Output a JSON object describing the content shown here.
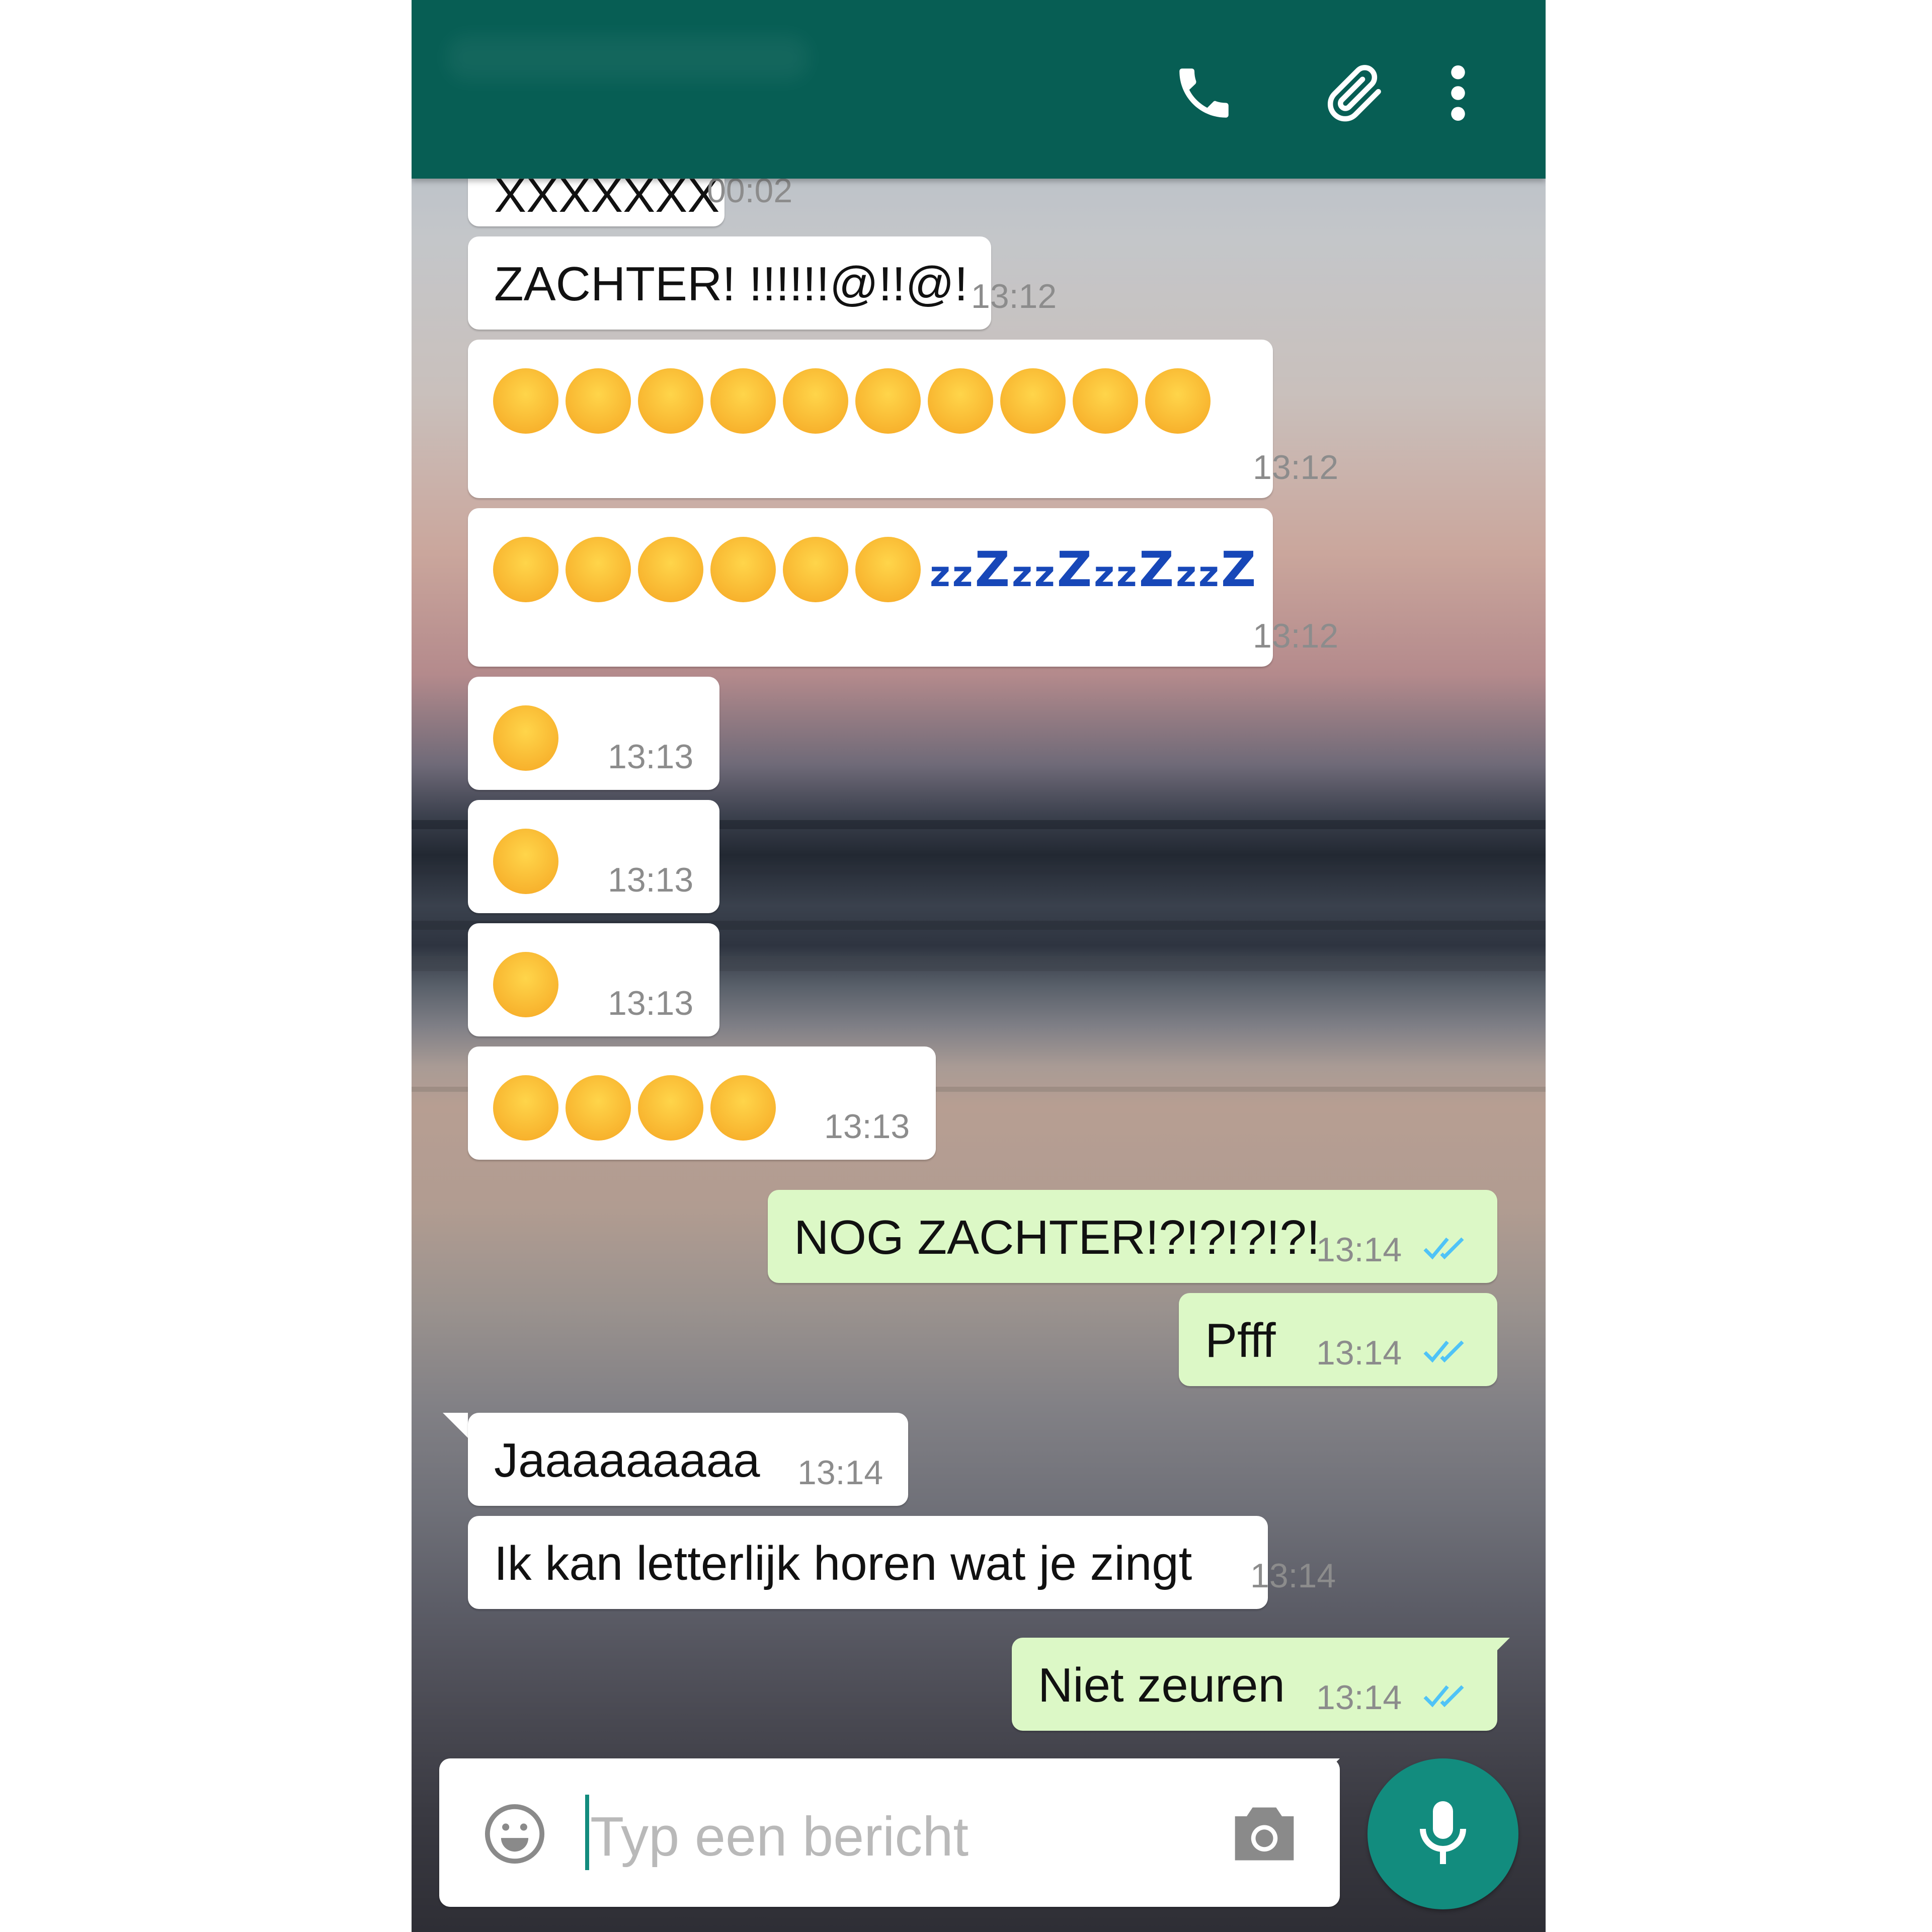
{
  "header": {
    "call_label": "call",
    "attach_label": "attach",
    "menu_label": "menu"
  },
  "messages": [
    {
      "type": "in",
      "text": "XXXXXXX",
      "time": "00:02"
    },
    {
      "type": "in",
      "text": "ZACHTER! !!!!!!@!!@!",
      "time": "13:12"
    },
    {
      "type": "in",
      "emoji": "persevering-face x10",
      "time": "13:12"
    },
    {
      "type": "in",
      "emoji": "confounded-face x6 + sleeping-zzz x4",
      "time": "13:12"
    },
    {
      "type": "in",
      "emoji": "persevering-face",
      "time": "13:13"
    },
    {
      "type": "in",
      "emoji": "confounded-face",
      "time": "13:13"
    },
    {
      "type": "in",
      "emoji": "confounded-face",
      "time": "13:13"
    },
    {
      "type": "in",
      "emoji": "kissing-closed-eyes x4",
      "time": "13:13"
    },
    {
      "type": "out",
      "text": "NOG ZACHTER!?!?!?!?!",
      "time": "13:14",
      "status": "read"
    },
    {
      "type": "out",
      "text": "Pfff",
      "time": "13:14",
      "status": "read"
    },
    {
      "type": "in",
      "text": "Jaaaaaaaaa",
      "time": "13:14"
    },
    {
      "type": "in",
      "text": "Ik kan letterlijk horen wat je zingt",
      "time": "13:14"
    },
    {
      "type": "out",
      "text": "Niet zeuren",
      "time": "13:14",
      "status": "read"
    }
  ],
  "composer": {
    "placeholder": "Typ een bericht"
  },
  "colors": {
    "header": "#075e54",
    "outgoing_bubble": "#dcf8c6",
    "incoming_bubble": "#ffffff",
    "mic_button": "#128c7e",
    "read_ticks": "#4fc3f7",
    "zzz": "#1747b8"
  },
  "icons": [
    "phone-icon",
    "paperclip-icon",
    "more-vert-icon",
    "emoji-icon",
    "camera-icon",
    "mic-icon",
    "double-check-icon"
  ]
}
